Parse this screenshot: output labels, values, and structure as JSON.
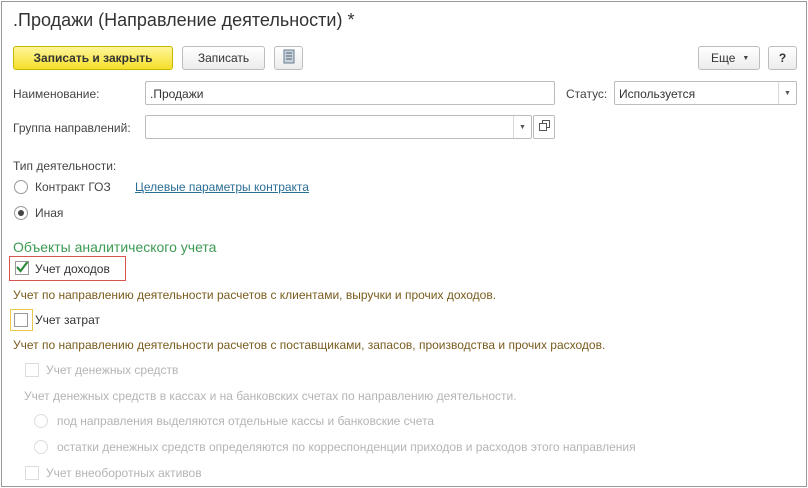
{
  "window": {
    "title": ".Продажи (Направление деятельности) *"
  },
  "toolbar": {
    "save_close": "Записать и закрыть",
    "save": "Записать",
    "more": "Еще",
    "help": "?"
  },
  "form": {
    "name_label": "Наименование:",
    "name_value": ".Продажи",
    "status_label": "Статус:",
    "status_value": "Используется",
    "group_label": "Группа направлений:",
    "group_value": "",
    "activity_type_label": "Тип деятельности:",
    "activity_options": [
      {
        "label": "Контракт ГОЗ",
        "selected": false
      },
      {
        "label": "Иная",
        "selected": true
      }
    ],
    "contract_link": "Целевые параметры контракта"
  },
  "analytics": {
    "section_title": "Объекты аналитического учета",
    "income": {
      "label": "Учет доходов",
      "checked": true,
      "hint": "Учет по направлению деятельности расчетов с клиентами, выручки и прочих доходов."
    },
    "costs": {
      "label": "Учет затрат",
      "checked": false,
      "hint": "Учет по направлению деятельности расчетов с поставщиками, запасов, производства и прочих расходов."
    },
    "cash": {
      "label": "Учет денежных средств",
      "checked": false,
      "disabled": true,
      "hint": "Учет денежных средств в кассах и на банковских счетах по направлению деятельности.",
      "options": [
        {
          "label": "под направления выделяются отдельные кассы и банковские счета"
        },
        {
          "label": "остатки денежных средств определяются по корреспонденции приходов и расходов этого направления"
        }
      ]
    },
    "assets": {
      "label": "Учет внеоборотных активов",
      "checked": false,
      "disabled": true
    }
  },
  "colors": {
    "primary_button": "#f5e02a",
    "section_title": "#3d9a53",
    "hint_text": "#7a5c1e",
    "link": "#2a6e96",
    "highlight_red": "#d9534f",
    "highlight_yellow": "#e9c74a",
    "checkmark": "#2f8a3a"
  }
}
